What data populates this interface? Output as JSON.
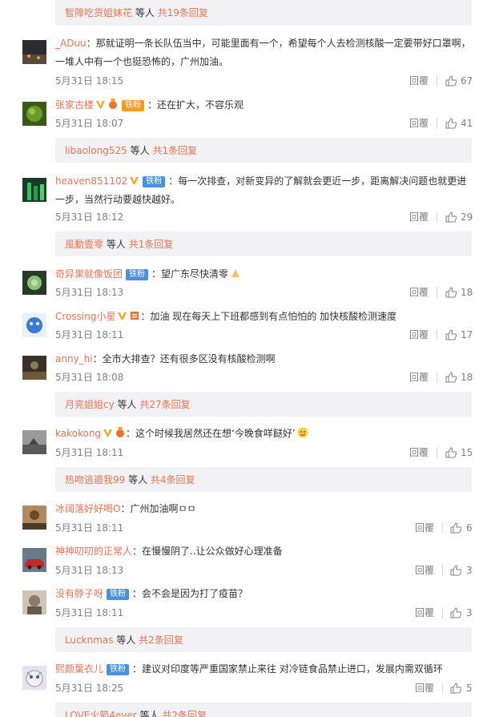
{
  "reply_boxes": [
    {
      "name": "智障吃货姐妹花",
      "mid": " 等人 ",
      "count": "共19条回复"
    },
    {
      "name": "libaolong525",
      "mid": " 等人 ",
      "count": "共1条回复"
    },
    {
      "name": "風動壹零",
      "mid": " 等人 ",
      "count": "共1条回复"
    },
    {
      "name": "月亮姐姐cy",
      "mid": " 等人 ",
      "count": "共27条回复"
    },
    {
      "name": "热吻逃遁我99",
      "mid": " 等人 ",
      "count": "共4条回复"
    },
    {
      "name": "Lucknmas",
      "mid": " 等人 ",
      "count": "共2条回复"
    },
    {
      "name": "LOVE火箭4ever",
      "mid": " 等人 ",
      "count": "共2条回复"
    }
  ],
  "comments": [
    {
      "user": "_ADuu",
      "text": "：那就证明一条长队伍当中，可能里面有一个，希望每个人去检测核酸一定要带好口罩啊，一堆人中有一个也挺恐怖的，广州加油。",
      "time": "5月31日 18:15",
      "reply": "回覆",
      "likes": "67",
      "fan": "",
      "avatar_color": "#3a3a3a"
    },
    {
      "user": "张家古楼",
      "text": "：还在扩大，不容乐观",
      "time": "5月31日 18:07",
      "reply": "回覆",
      "likes": "41",
      "fan": "铁粉",
      "avatar_color": "#4a6a2a"
    },
    {
      "user": "heaven851102",
      "text": "：每一次排查，对新变异的了解就会更近一步，距离解决问题也就更进一步，当然行动要越快越好。",
      "time": "5月31日 18:12",
      "reply": "回覆",
      "likes": "29",
      "fan": "铁粉",
      "avatar_color": "#2e6b3a"
    },
    {
      "user": "奇异果就像饭团",
      "text": "：望广东尽快清零",
      "time": "5月31日 18:13",
      "reply": "回覆",
      "likes": "18",
      "fan": "铁粉",
      "avatar_color": "#6a8a5a"
    },
    {
      "user": "Crossing小星",
      "text": "：加油 现在每天上下班都感到有点怕怕的  加快核酸检测速度",
      "time": "5月31日 18:11",
      "reply": "回覆",
      "likes": "17",
      "fan": "",
      "avatar_color": "#3a7bd5"
    },
    {
      "user": "anny_hi",
      "text": "：全市大排查？还有很多区没有核酸检测啊",
      "time": "5月31日 18:08",
      "reply": "回覆",
      "likes": "18",
      "fan": "",
      "avatar_color": "#4a3a2a"
    },
    {
      "user": "kakokong",
      "text": "：这个时候我居然还在想‘今晚食咩餸好’",
      "time": "5月31日 18:11",
      "reply": "回覆",
      "likes": "15",
      "fan": "",
      "avatar_color": "#777777"
    },
    {
      "user": "冰阔落好好喝O",
      "text": "：广州加油啊ㅁㅁ",
      "time": "5月31日 18:11",
      "reply": "回覆",
      "likes": "6",
      "fan": "",
      "avatar_color": "#8a6a3a"
    },
    {
      "user": "神神叨叨的正常人",
      "text": "：在慢慢阴了..让公众做好心理准备",
      "time": "5月31日 18:13",
      "reply": "回覆",
      "likes": "3",
      "fan": "",
      "avatar_color": "#a03030"
    },
    {
      "user": "没有脖子呀",
      "text": "：会不会是因为打了疫苗？",
      "time": "5月31日 18:11",
      "reply": "回覆",
      "likes": "3",
      "fan": "铁粉",
      "avatar_color": "#9a8a7a"
    },
    {
      "user": "熙颜葉衣儿",
      "text": "：建议对印度等严重国家禁止来往 对冷链食品禁止进口，发展内需双循环",
      "time": "5月31日 18:25",
      "reply": "回覆",
      "likes": "5",
      "fan": "铁粉",
      "avatar_color": "#c0b0d0"
    }
  ]
}
